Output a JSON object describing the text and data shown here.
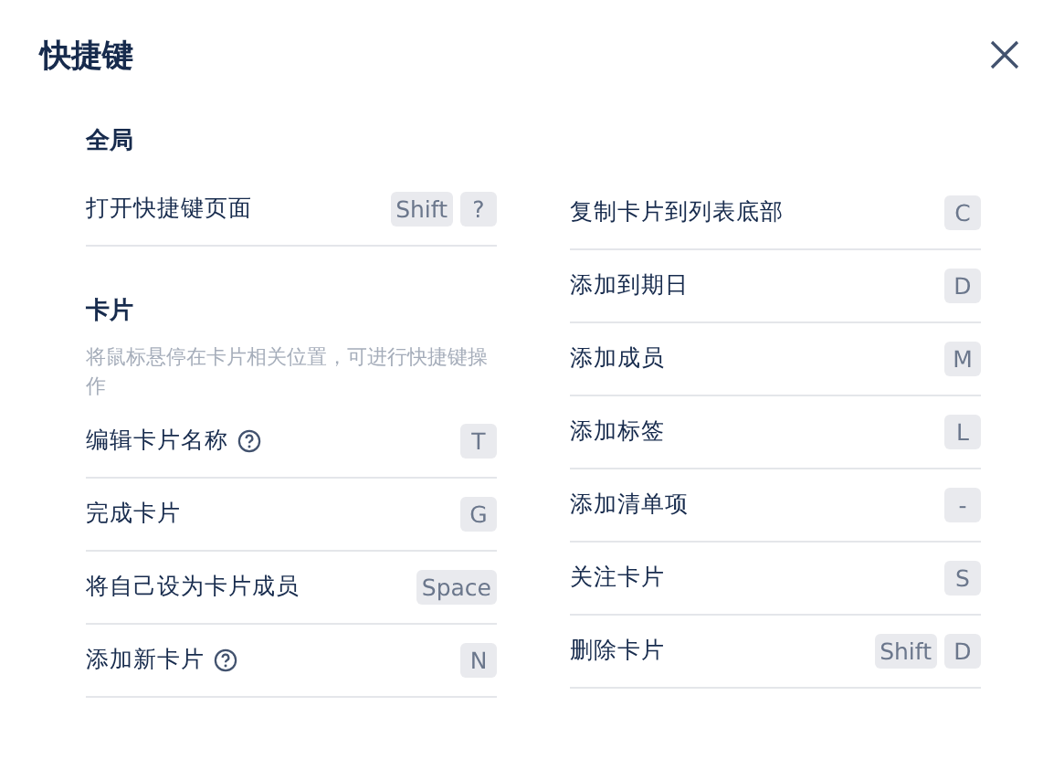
{
  "title": "快捷键",
  "left_sections": [
    {
      "heading": "全局",
      "rows": [
        {
          "label": "打开快捷键页面",
          "help": false,
          "keys": [
            "Shift",
            "?"
          ]
        }
      ]
    },
    {
      "heading": "卡片",
      "description": "将鼠标悬停在卡片相关位置，可进行快捷键操作",
      "rows": [
        {
          "label": "编辑卡片名称",
          "help": true,
          "keys": [
            "T"
          ]
        },
        {
          "label": "完成卡片",
          "help": false,
          "keys": [
            "G"
          ]
        },
        {
          "label": "将自己设为卡片成员",
          "help": false,
          "keys": [
            "Space"
          ]
        },
        {
          "label": "添加新卡片",
          "help": true,
          "keys": [
            "N"
          ]
        }
      ]
    }
  ],
  "right_rows": [
    {
      "label": "复制卡片到列表底部",
      "help": false,
      "keys": [
        "C"
      ]
    },
    {
      "label": "添加到期日",
      "help": false,
      "keys": [
        "D"
      ]
    },
    {
      "label": "添加成员",
      "help": false,
      "keys": [
        "M"
      ]
    },
    {
      "label": "添加标签",
      "help": false,
      "keys": [
        "L"
      ]
    },
    {
      "label": "添加清单项",
      "help": false,
      "keys": [
        "-"
      ]
    },
    {
      "label": "关注卡片",
      "help": false,
      "keys": [
        "S"
      ]
    },
    {
      "label": "删除卡片",
      "help": false,
      "keys": [
        "Shift",
        "D"
      ]
    }
  ]
}
